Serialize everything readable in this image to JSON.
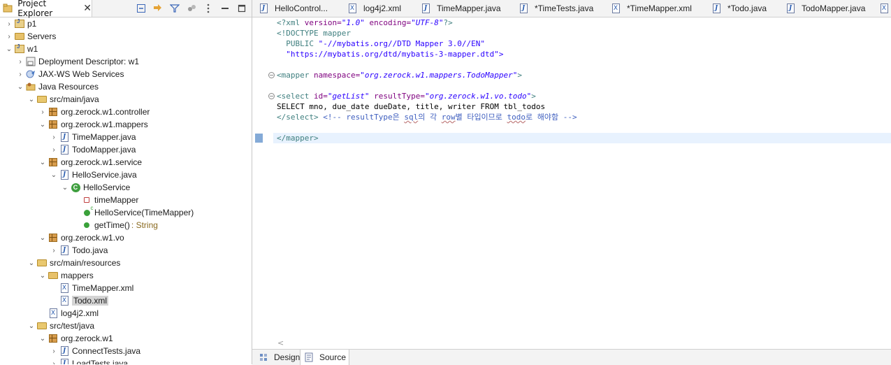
{
  "explorer": {
    "title": "Project Explorer",
    "close": "✕",
    "toolbar": [
      "collapse-all-icon",
      "link-with-editor-icon",
      "filter-icon",
      "focus-icon",
      "view-menu-icon",
      "minimize-icon",
      "maximize-icon"
    ],
    "tree": [
      {
        "label": "p1",
        "icon": "project-icon",
        "chev": "›",
        "depth": 0
      },
      {
        "label": "Servers",
        "icon": "folder-icon",
        "chev": "›",
        "depth": 0
      },
      {
        "label": "w1",
        "icon": "project-icon",
        "chev": "⌄",
        "depth": 0
      },
      {
        "label": "Deployment Descriptor: w1",
        "icon": "deployment-descriptor-icon",
        "chev": "›",
        "depth": 1
      },
      {
        "label": "JAX-WS Web Services",
        "icon": "web-services-icon",
        "chev": "›",
        "depth": 1
      },
      {
        "label": "Java Resources",
        "icon": "java-resources-icon",
        "chev": "⌄",
        "depth": 1
      },
      {
        "label": "src/main/java",
        "icon": "source-folder-icon",
        "chev": "⌄",
        "depth": 2
      },
      {
        "label": "org.zerock.w1.controller",
        "icon": "package-icon",
        "chev": "›",
        "depth": 3
      },
      {
        "label": "org.zerock.w1.mappers",
        "icon": "package-icon",
        "chev": "⌄",
        "depth": 3
      },
      {
        "label": "TimeMapper.java",
        "icon": "java-interface-icon",
        "chev": "›",
        "depth": 4
      },
      {
        "label": "TodoMapper.java",
        "icon": "java-interface-icon",
        "chev": "›",
        "depth": 4
      },
      {
        "label": "org.zerock.w1.service",
        "icon": "package-icon",
        "chev": "⌄",
        "depth": 3
      },
      {
        "label": "HelloService.java",
        "icon": "java-file-icon",
        "chev": "⌄",
        "depth": 4
      },
      {
        "label": "HelloService",
        "icon": "class-icon",
        "chev": "⌄",
        "depth": 5
      },
      {
        "label": "timeMapper",
        "icon": "field-icon",
        "chev": "",
        "depth": 6
      },
      {
        "label": "HelloService(TimeMapper)",
        "icon": "constructor-icon",
        "chev": "",
        "depth": 6
      },
      {
        "label": "getTime()",
        "decoration": " : String",
        "icon": "method-icon",
        "chev": "",
        "depth": 6
      },
      {
        "label": "org.zerock.w1.vo",
        "icon": "package-icon",
        "chev": "⌄",
        "depth": 3
      },
      {
        "label": "Todo.java",
        "icon": "java-file-icon",
        "chev": "›",
        "depth": 4
      },
      {
        "label": "src/main/resources",
        "icon": "source-folder-icon",
        "chev": "⌄",
        "depth": 2
      },
      {
        "label": "mappers",
        "icon": "folder-icon",
        "chev": "⌄",
        "depth": 3
      },
      {
        "label": "TimeMapper.xml",
        "icon": "xml-file-icon",
        "chev": "",
        "depth": 4
      },
      {
        "label": "Todo.xml",
        "icon": "xml-file-icon",
        "chev": "",
        "depth": 4,
        "selected": true
      },
      {
        "label": "log4j2.xml",
        "icon": "xml-file-icon",
        "chev": "",
        "depth": 3
      },
      {
        "label": "src/test/java",
        "icon": "source-folder-icon",
        "chev": "⌄",
        "depth": 2
      },
      {
        "label": "org.zerock.w1",
        "icon": "package-icon",
        "chev": "⌄",
        "depth": 3
      },
      {
        "label": "ConnectTests.java",
        "icon": "java-file-icon",
        "chev": "›",
        "depth": 4
      },
      {
        "label": "LoadTests.java",
        "icon": "java-file-icon",
        "chev": "›",
        "depth": 4
      }
    ]
  },
  "editor_tabs": [
    {
      "label": "HelloControl...",
      "icon": "java-file-icon"
    },
    {
      "label": "log4j2.xml",
      "icon": "xml-file-icon"
    },
    {
      "label": "TimeMapper.java",
      "icon": "java-file-icon"
    },
    {
      "label": "*TimeTests.java",
      "icon": "java-file-icon"
    },
    {
      "label": "*TimeMapper.xml",
      "icon": "xml-file-icon"
    },
    {
      "label": "*Todo.java",
      "icon": "java-file-icon"
    },
    {
      "label": "TodoMapper.java",
      "icon": "java-file-icon"
    }
  ],
  "code": {
    "l1": {
      "open": "<?xml ",
      "a1": "version=",
      "v1": "\"1.0\"",
      "sp": " ",
      "a2": "encoding=",
      "v2": "\"UTF-8\"",
      "close": "?>"
    },
    "l2": "<!DOCTYPE mapper",
    "l3": {
      "kw": "  PUBLIC ",
      "s": "\"-//mybatis.org//DTD Mapper 3.0//EN\""
    },
    "l4": "  \"https://mybatis.org/dtd/mybatis-3-mapper.dtd\">",
    "l6": {
      "open": "<mapper ",
      "a": "namespace=",
      "v": "\"org.zerock.w1.mappers.TodoMapper\"",
      "close": ">"
    },
    "l8": {
      "open": "<select ",
      "a1": "id=",
      "v1": "\"getList\"",
      "sp": " ",
      "a2": "resultType=",
      "v2": "\"org.zerock.w1.vo.todo\"",
      "close": ">"
    },
    "l9": "SELECT mno, due_date dueDate, title, writer FROM tbl_todos",
    "l10": {
      "tag": "</select>",
      "cmt": " <!-- resultType은 sql의 각 row별 타입이므로 todo로 해야함 -->"
    },
    "l12": "</mapper>"
  },
  "bottom_tabs": [
    {
      "label": "Design",
      "icon": "design-icon"
    },
    {
      "label": "Source",
      "icon": "source-icon",
      "active": true
    }
  ],
  "scroll_left": "<"
}
